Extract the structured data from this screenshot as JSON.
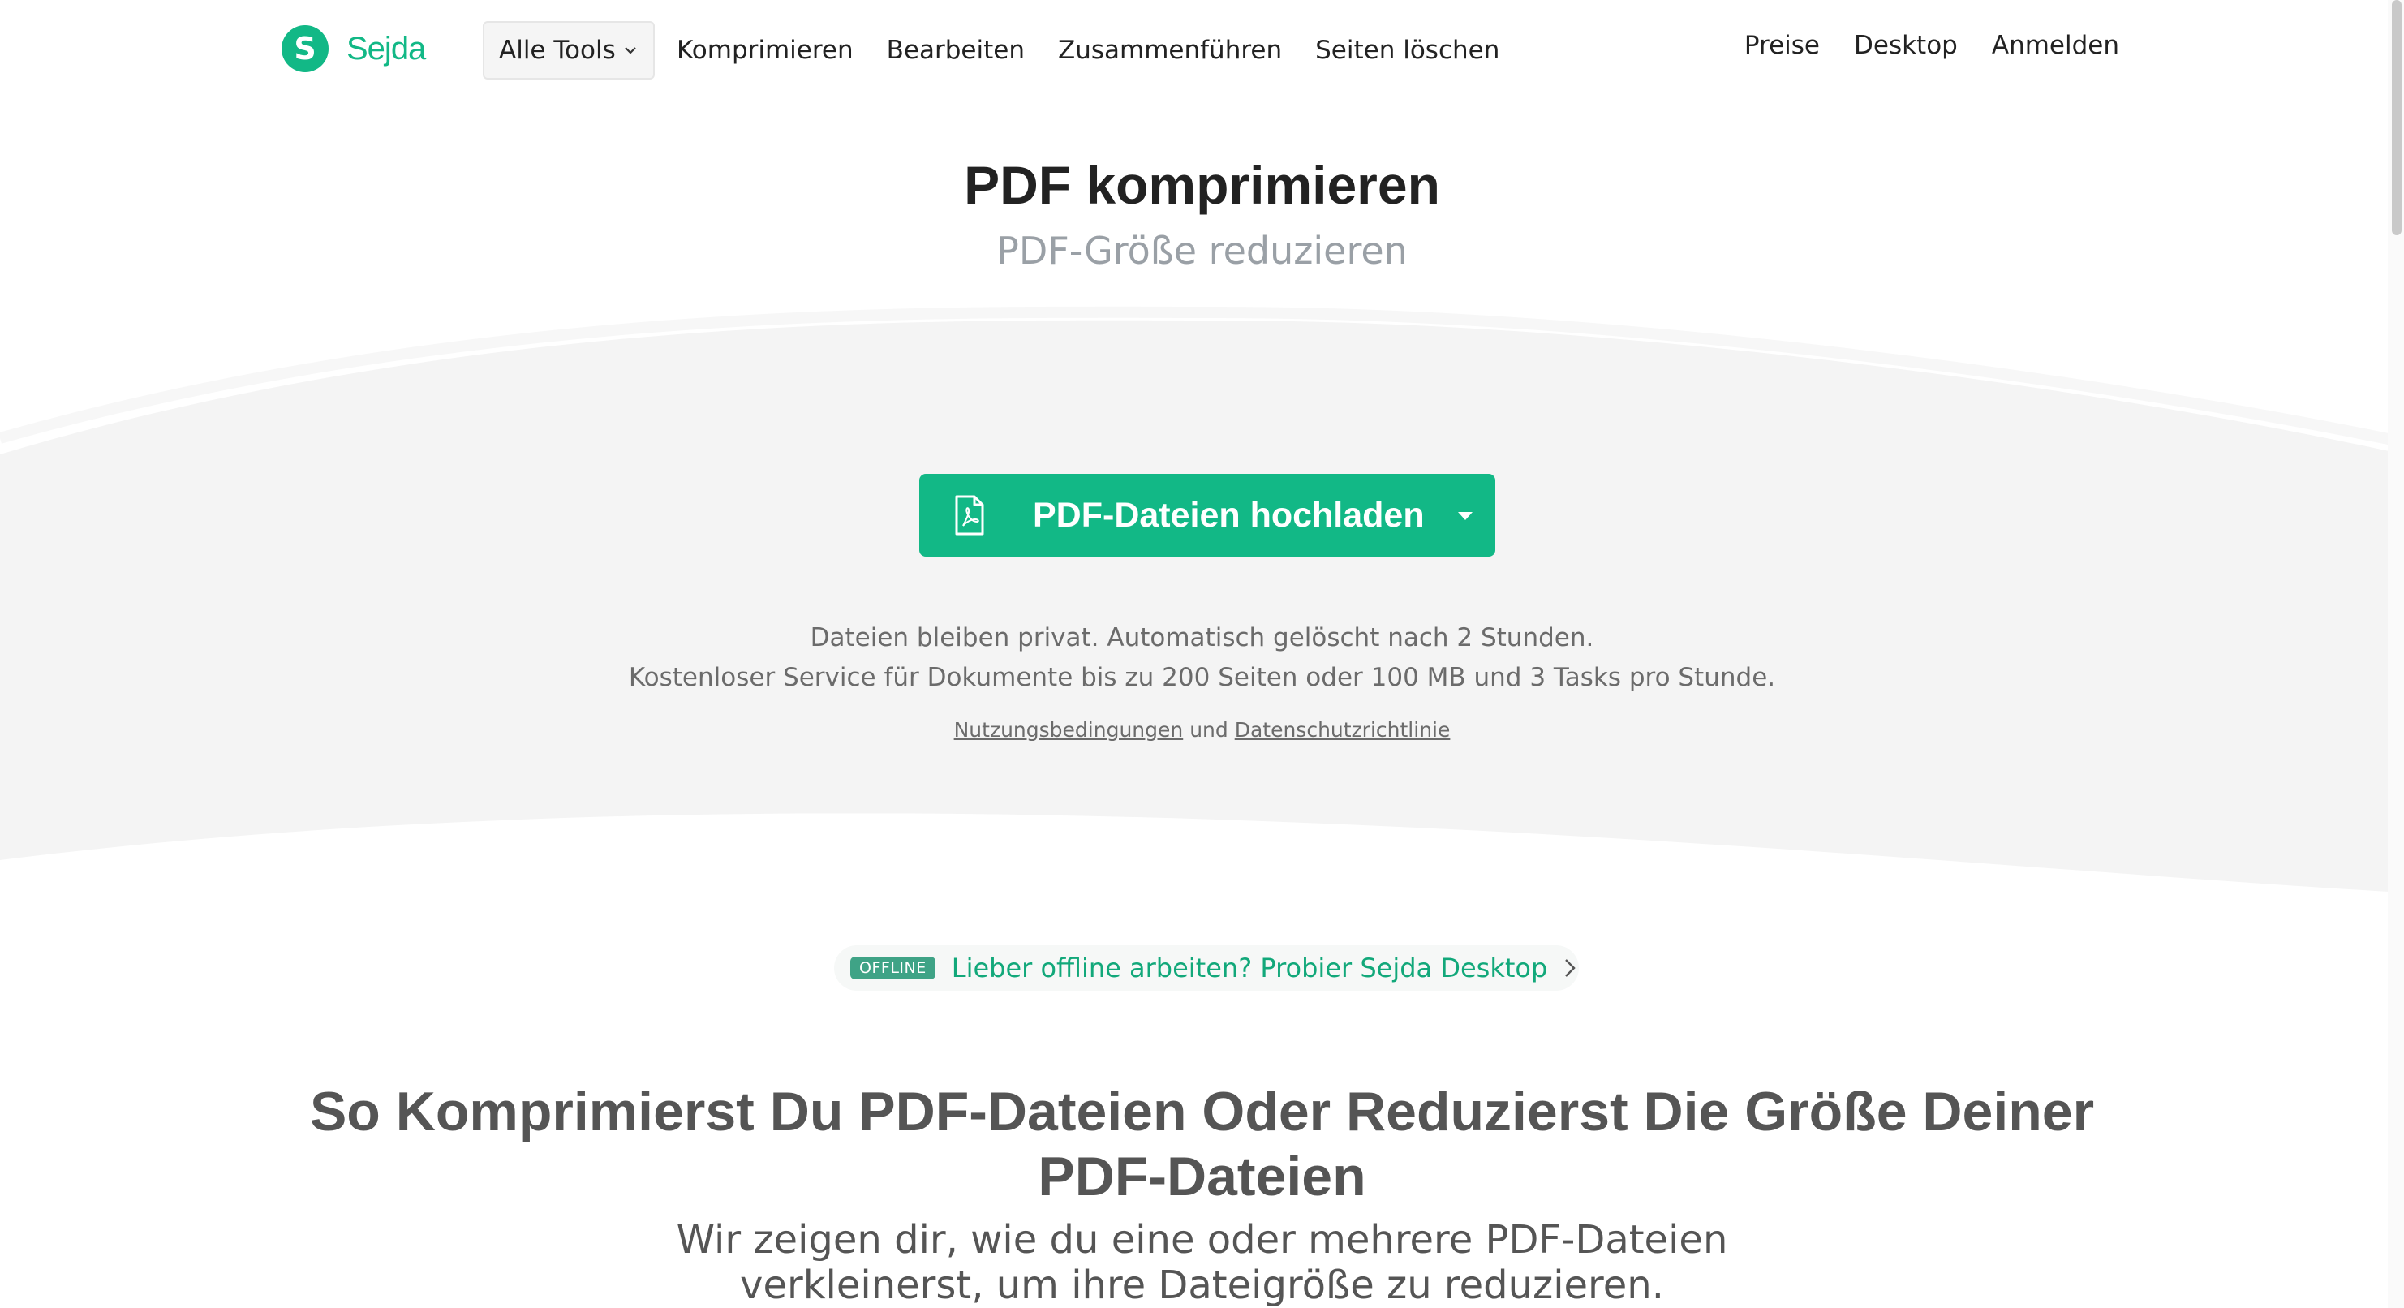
{
  "brand": {
    "logo_letter": "S",
    "name": "Sejda",
    "color": "#12b886"
  },
  "nav": {
    "tools_label": "Alle Tools",
    "links": [
      "Komprimieren",
      "Bearbeiten",
      "Zusammenführen",
      "Seiten löschen"
    ],
    "right_links": [
      "Preise",
      "Desktop",
      "Anmelden"
    ]
  },
  "hero": {
    "title": "PDF komprimieren",
    "subtitle": "PDF-Größe reduzieren",
    "upload_label": "PDF-Dateien hochladen",
    "upload_icon": "pdf-file-icon",
    "info_line1": "Dateien bleiben privat. Automatisch gelöscht nach 2 Stunden.",
    "info_line2": "Kostenloser Service für Dokumente bis zu 200 Seiten oder 100 MB und 3 Tasks pro Stunde.",
    "terms_link": "Nutzungsbedingungen",
    "terms_and": "und",
    "privacy_link": "Datenschutzrichtlinie"
  },
  "offline": {
    "badge": "OFFLINE",
    "text": "Lieber offline arbeiten? Probier Sejda Desktop"
  },
  "howto": {
    "heading": "So Komprimierst Du PDF-Dateien Oder Reduzierst Die Größe Deiner PDF-Dateien",
    "subheading": "Wir zeigen dir, wie du eine oder mehrere PDF-Dateien verkleinerst, um ihre Dateigröße zu reduzieren."
  }
}
